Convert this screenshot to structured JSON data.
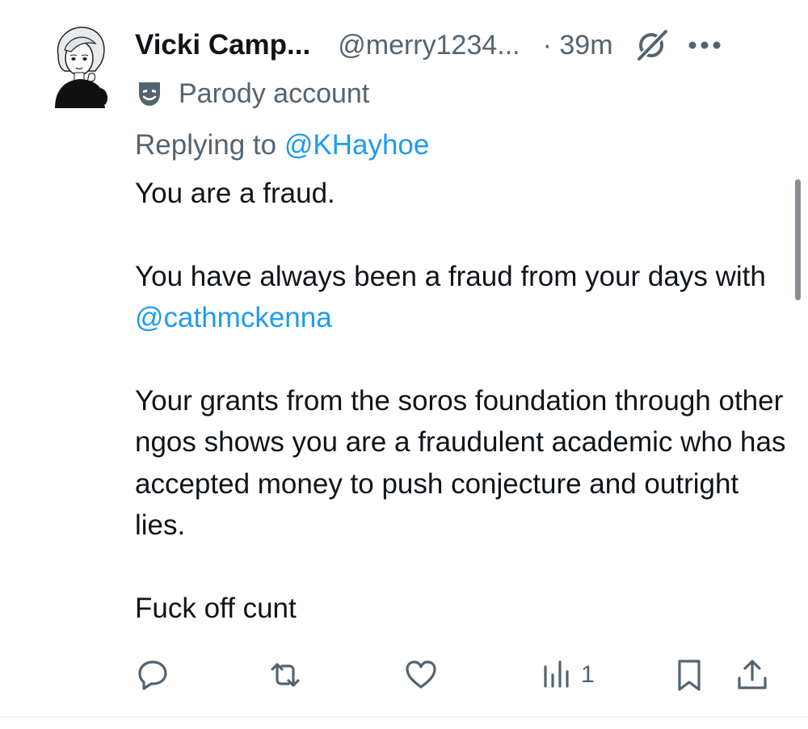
{
  "tweet": {
    "author_name": "Vicki Camp...",
    "author_handle": "@merry1234...",
    "time": "· 39m",
    "parody_label": "Parody account",
    "replying_prefix": "Replying to ",
    "replying_to": "@KHayhoe",
    "text": {
      "line1": "You are a fraud.",
      "para2_before": "You have always been a fraud from your days with ",
      "para2_mention": "@cathmckenna",
      "para3": "Your grants from the soros foundation through other ngos shows you are a fraudulent academic who has accepted money to push conjecture and outright lies.",
      "para4": "Fuck off cunt"
    },
    "views_count": "1"
  },
  "icons": {
    "avatar": "avatar-illustration",
    "grok": "grok-icon",
    "more": "more-icon",
    "parody": "parody-mask-icon",
    "reply": "reply-icon",
    "retweet": "retweet-icon",
    "like": "like-icon",
    "views": "views-icon",
    "bookmark": "bookmark-icon",
    "share": "share-icon"
  },
  "colors": {
    "link": "#1d9bf0",
    "secondary_text": "#536471",
    "primary_text": "#0f1419"
  }
}
